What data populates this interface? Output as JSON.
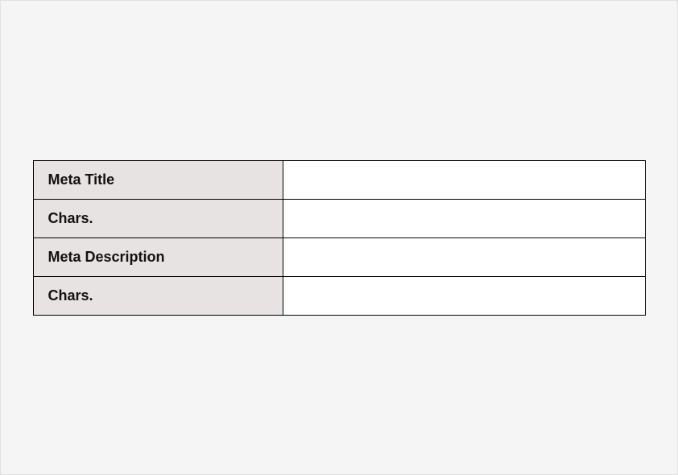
{
  "table": {
    "rows": [
      {
        "label": "Meta Title",
        "value": ""
      },
      {
        "label": "Chars.",
        "value": ""
      },
      {
        "label": "Meta Description",
        "value": ""
      },
      {
        "label": "Chars.",
        "value": ""
      }
    ]
  }
}
